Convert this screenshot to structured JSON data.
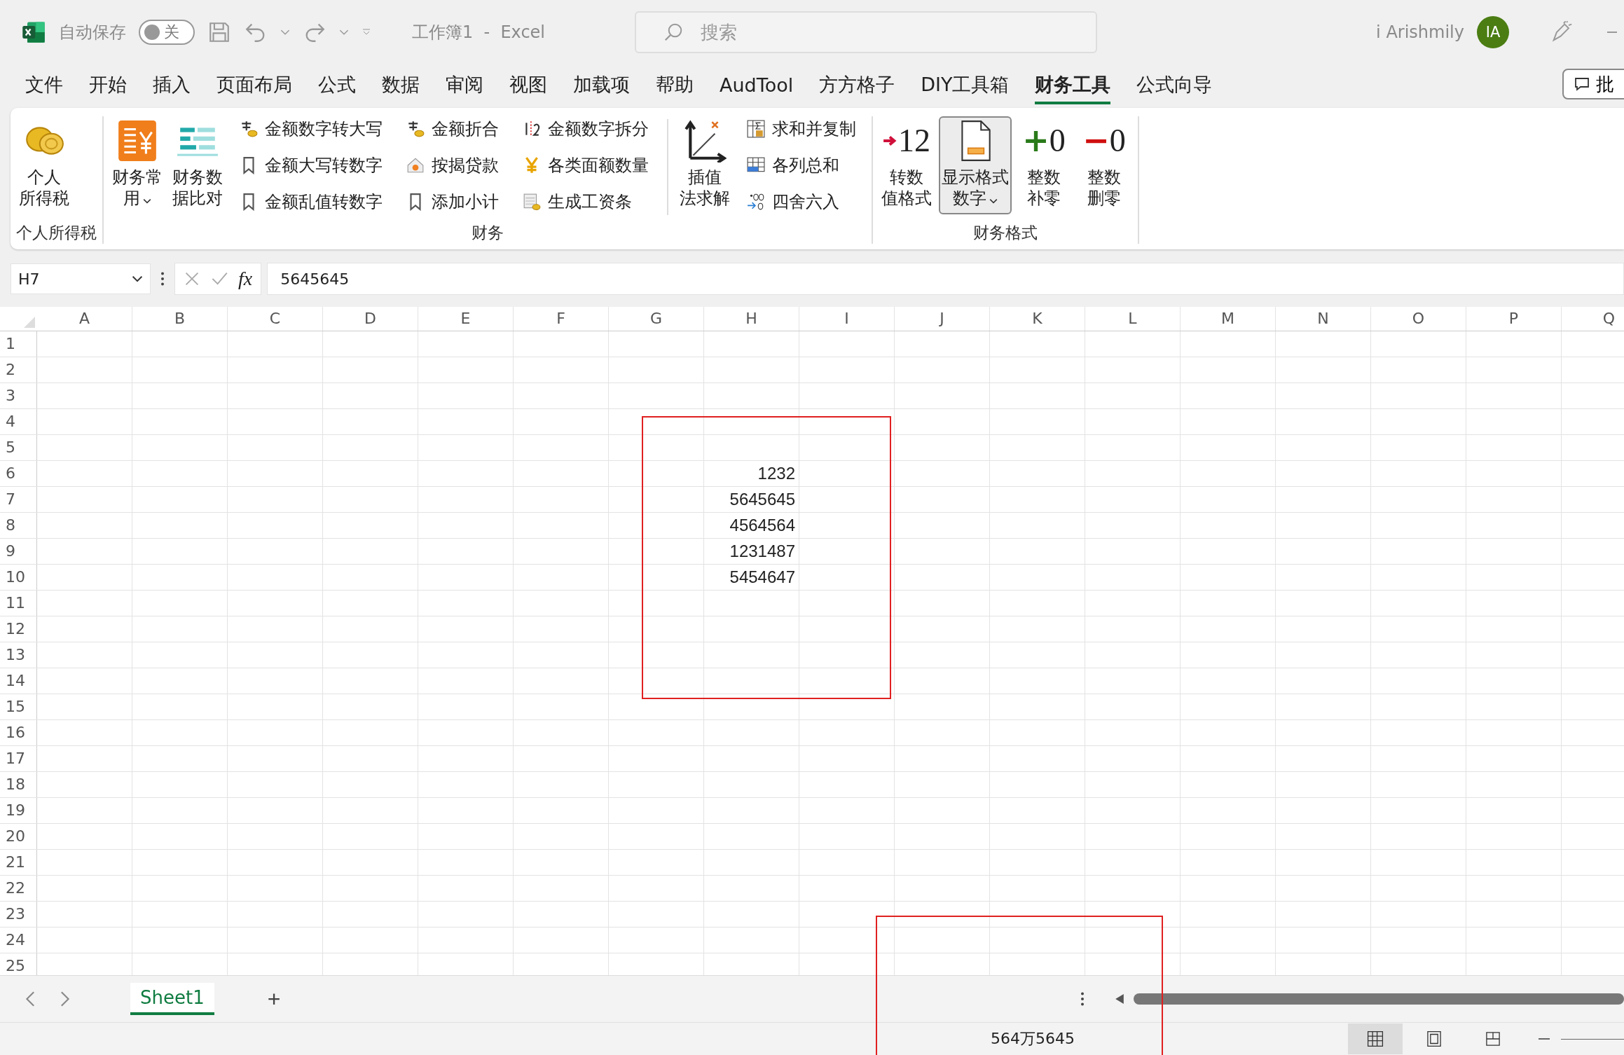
{
  "titlebar": {
    "autosave_label": "自动保存",
    "autosave_toggle": {
      "label": "关",
      "on": false
    },
    "title": "工作簿1  -  Excel",
    "search": {
      "placeholder": "搜索"
    },
    "user_name": "i Arishmily",
    "avatar_initials": "IA"
  },
  "menu_tabs": [
    {
      "label": "文件",
      "selected": false
    },
    {
      "label": "开始",
      "selected": false
    },
    {
      "label": "插入",
      "selected": false
    },
    {
      "label": "页面布局",
      "selected": false
    },
    {
      "label": "公式",
      "selected": false
    },
    {
      "label": "数据",
      "selected": false
    },
    {
      "label": "审阅",
      "selected": false
    },
    {
      "label": "视图",
      "selected": false
    },
    {
      "label": "加载项",
      "selected": false
    },
    {
      "label": "帮助",
      "selected": false
    },
    {
      "label": "AudTool",
      "selected": false
    },
    {
      "label": "方方格子",
      "selected": false
    },
    {
      "label": "DIY工具箱",
      "selected": false
    },
    {
      "label": "财务工具",
      "selected": true
    },
    {
      "label": "公式向导",
      "selected": false
    }
  ],
  "comments_button": "批",
  "ribbon": {
    "groups": [
      {
        "label": "个人所得税",
        "items": [
          {
            "kind": "big",
            "label": "个人所得税"
          }
        ]
      },
      {
        "label": "财务",
        "items": [
          {
            "kind": "big",
            "label": "财务常用",
            "dropdown": true
          },
          {
            "kind": "big",
            "label": "财务数据比对"
          },
          {
            "kind": "column",
            "buttons": [
              {
                "label": "金额数字转大写"
              },
              {
                "label": "金额大写转数字"
              },
              {
                "label": "金额乱值转数字"
              }
            ]
          },
          {
            "kind": "column",
            "buttons": [
              {
                "label": "金额折合"
              },
              {
                "label": "按揭贷款"
              },
              {
                "label": "添加小计"
              }
            ]
          },
          {
            "kind": "column",
            "buttons": [
              {
                "label": "金额数字拆分"
              },
              {
                "label": "各类面额数量"
              },
              {
                "label": "生成工资条"
              }
            ]
          },
          {
            "kind": "separator"
          },
          {
            "kind": "big",
            "label": "插值法求解"
          },
          {
            "kind": "column",
            "buttons": [
              {
                "label": "求和并复制"
              },
              {
                "label": "各列总和"
              },
              {
                "label": "四舍六入"
              }
            ]
          }
        ]
      },
      {
        "label": "财务格式",
        "items": [
          {
            "kind": "glyph",
            "label": "转数值格式",
            "glyph": "12"
          },
          {
            "kind": "big",
            "label": "显示格式数字",
            "dropdown": true,
            "pressed": true
          },
          {
            "kind": "glyph",
            "label": "整数补零",
            "glyph": "+0"
          },
          {
            "kind": "glyph",
            "label": "整数删零",
            "glyph": "−0"
          }
        ]
      }
    ]
  },
  "formula_bar": {
    "name_box": "H7",
    "fx": "fx",
    "value": "5645645"
  },
  "grid": {
    "columns": [
      "A",
      "B",
      "C",
      "D",
      "E",
      "F",
      "G",
      "H",
      "I",
      "J",
      "K",
      "L",
      "M",
      "N",
      "O",
      "P",
      "Q"
    ],
    "rows": [
      {
        "label": "1"
      },
      {
        "label": "2"
      },
      {
        "label": "3"
      },
      {
        "label": "4"
      },
      {
        "label": "5"
      },
      {
        "label": "6",
        "cells": {
          "H": "1232"
        }
      },
      {
        "label": "7",
        "cells": {
          "H": "5645645"
        }
      },
      {
        "label": "8",
        "cells": {
          "H": "4564564"
        }
      },
      {
        "label": "9",
        "cells": {
          "H": "1231487"
        }
      },
      {
        "label": "10",
        "cells": {
          "H": "5454647"
        }
      },
      {
        "label": "11"
      },
      {
        "label": "12"
      },
      {
        "label": "13"
      },
      {
        "label": "14"
      },
      {
        "label": "15"
      },
      {
        "label": "16"
      },
      {
        "label": "17"
      },
      {
        "label": "18"
      },
      {
        "label": "19"
      },
      {
        "label": "20"
      },
      {
        "label": "21"
      },
      {
        "label": "22"
      },
      {
        "label": "23"
      },
      {
        "label": "24"
      },
      {
        "label": "25"
      }
    ]
  },
  "sheet_tabs": [
    {
      "label": "Sheet1",
      "selected": true
    }
  ],
  "add_sheet": "+",
  "status_bar": {
    "sum": "564万5645",
    "views": [
      {
        "kind": "normal",
        "selected": true
      },
      {
        "kind": "layout",
        "selected": false
      },
      {
        "kind": "break",
        "selected": false
      }
    ]
  },
  "highlight_boxes": {
    "around_values": true,
    "around_status_sum": true
  }
}
